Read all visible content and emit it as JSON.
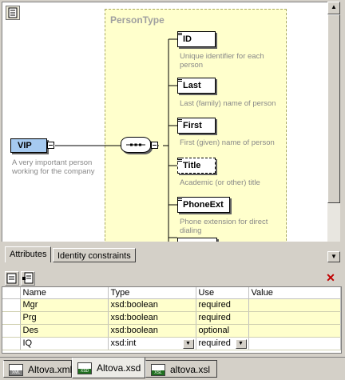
{
  "diagram": {
    "complex_type": "PersonType",
    "root_element": {
      "name": "VIP",
      "description": "A very important person\nworking for the company"
    },
    "children": [
      {
        "name": "ID",
        "description": "Unique identifier for each\nperson",
        "optional": false
      },
      {
        "name": "Last",
        "description": "Last (family) name of person",
        "optional": false
      },
      {
        "name": "First",
        "description": "First (given) name of person",
        "optional": false
      },
      {
        "name": "Title",
        "description": "Academic (or other) title",
        "optional": true
      },
      {
        "name": "PhoneExt",
        "description": "Phone extension for direct\ndialing",
        "optional": false
      }
    ]
  },
  "panel_tabs": [
    "Attributes",
    "Identity constraints"
  ],
  "attributes": {
    "columns": [
      "Name",
      "Type",
      "Use",
      "Value"
    ],
    "rows": [
      {
        "name": "Mgr",
        "type": "xsd:boolean",
        "use": "required",
        "value": ""
      },
      {
        "name": "Prg",
        "type": "xsd:boolean",
        "use": "required",
        "value": ""
      },
      {
        "name": "Des",
        "type": "xsd:boolean",
        "use": "optional",
        "value": ""
      },
      {
        "name": "IQ",
        "type": "xsd:int",
        "use": "required",
        "value": ""
      }
    ]
  },
  "doc_tabs": [
    {
      "label": "Altova.xml",
      "icon": "xml-file-icon",
      "tag": "XML"
    },
    {
      "label": "Altova.xsd",
      "icon": "xsd-file-icon",
      "tag": "XSD"
    },
    {
      "label": "altova.xsl",
      "icon": "xsl-file-icon",
      "tag": "XSL"
    }
  ],
  "colors": {
    "complex_type_bg": "#ffffcc",
    "root_element_bg": "#a6caf0",
    "close_icon": "#c00000"
  }
}
